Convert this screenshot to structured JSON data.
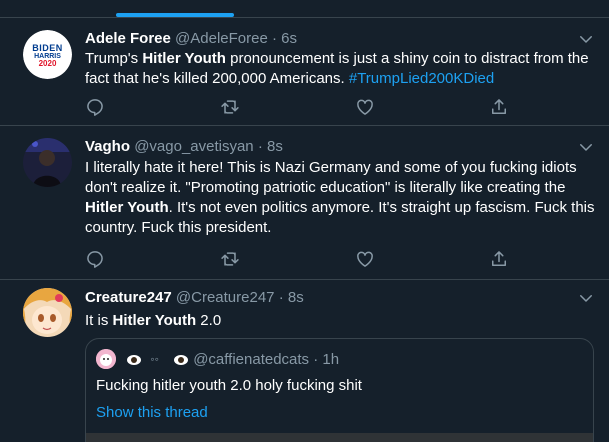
{
  "tweets": [
    {
      "name": "Adele Foree",
      "handle": "@AdeleForee",
      "dot": "·",
      "time": "6s",
      "avatar_text": {
        "line1": "BIDEN",
        "line2": "HARRIS",
        "line3": "2020"
      },
      "body": {
        "t1": "Trump's ",
        "b1": "Hitler Youth",
        "t2": " pronouncement is just a shiny coin to distract from the fact that he's killed 200,000 Americans. ",
        "hashtag": "#TrumpLied200KDied"
      }
    },
    {
      "name": "Vagho",
      "handle": "@vago_avetisyan",
      "dot": "·",
      "time": "8s",
      "body": {
        "t1": "I literally hate it here! This is Nazi Germany and some of you fucking idiots don't realize it. \"Promoting patriotic education\" is literally like creating the ",
        "b1": "Hitler Youth",
        "t2": ". It's not even politics anymore. It's straight up fascism. Fuck this country. Fuck this president."
      }
    },
    {
      "name": "Creature247",
      "handle": "@Creature247",
      "dot": "·",
      "time": "8s",
      "body": {
        "t1": "It is ",
        "b1": "Hitler Youth",
        "t2": " 2.0"
      },
      "quote": {
        "handle": "@caffienatedcats",
        "dot": "·",
        "time": "1h",
        "text": "Fucking hitler youth 2.0 holy fucking shit",
        "show_thread": "Show this thread"
      }
    }
  ],
  "colors": {
    "background": "#15202b",
    "border": "#38444d",
    "accent": "#1da1f2",
    "secondary_text": "#8899a6"
  },
  "icons": [
    "reply-icon",
    "retweet-icon",
    "like-icon",
    "share-icon",
    "chevron-down-icon",
    "eye-icon"
  ]
}
